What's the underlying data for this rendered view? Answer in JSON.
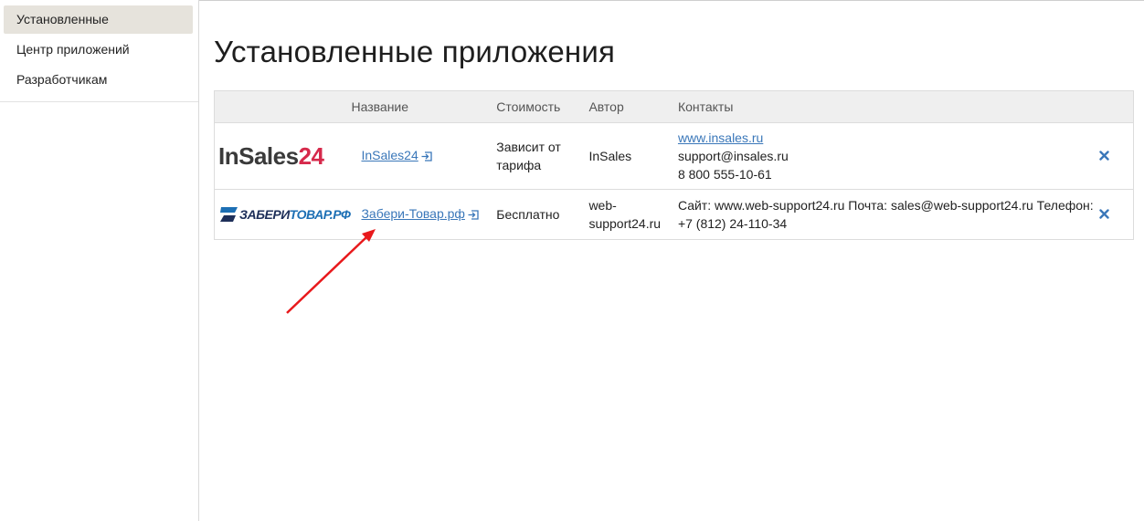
{
  "sidebar": {
    "items": [
      {
        "label": "Установленные",
        "active": true
      },
      {
        "label": "Центр приложений",
        "active": false
      },
      {
        "label": "Разработчикам",
        "active": false
      }
    ]
  },
  "main": {
    "title": "Установленные приложения",
    "table": {
      "headers": {
        "name": "Название",
        "price": "Стоимость",
        "author": "Автор",
        "contacts": "Контакты"
      },
      "rows": [
        {
          "logo_text_1": "InSales",
          "logo_text_2": "24",
          "name": "InSales24",
          "price": "Зависит от тарифа",
          "author": "InSales",
          "contact_site": "www.insales.ru",
          "contact_email": "support@insales.ru",
          "contact_phone": "8 800 555-10-61"
        },
        {
          "logo_text_1": "ЗАБЕРИ",
          "logo_text_2": "ТОВАР.РФ",
          "name": "Забери-Товар.рф",
          "price": "Бесплатно",
          "author": "web-support24.ru",
          "contacts": "Сайт: www.web-support24.ru Почта: sales@web-support24.ru Телефон: +7 (812) 24-110-34"
        }
      ]
    }
  },
  "colors": {
    "link": "#3a77b9",
    "active_menu_bg": "#e6e3dc",
    "table_header_bg": "#efefef",
    "annotation_arrow": "#e8191c",
    "insales_accent": "#d6294b"
  },
  "icons": {
    "external_link": "external-link-icon",
    "delete": "close-icon"
  }
}
